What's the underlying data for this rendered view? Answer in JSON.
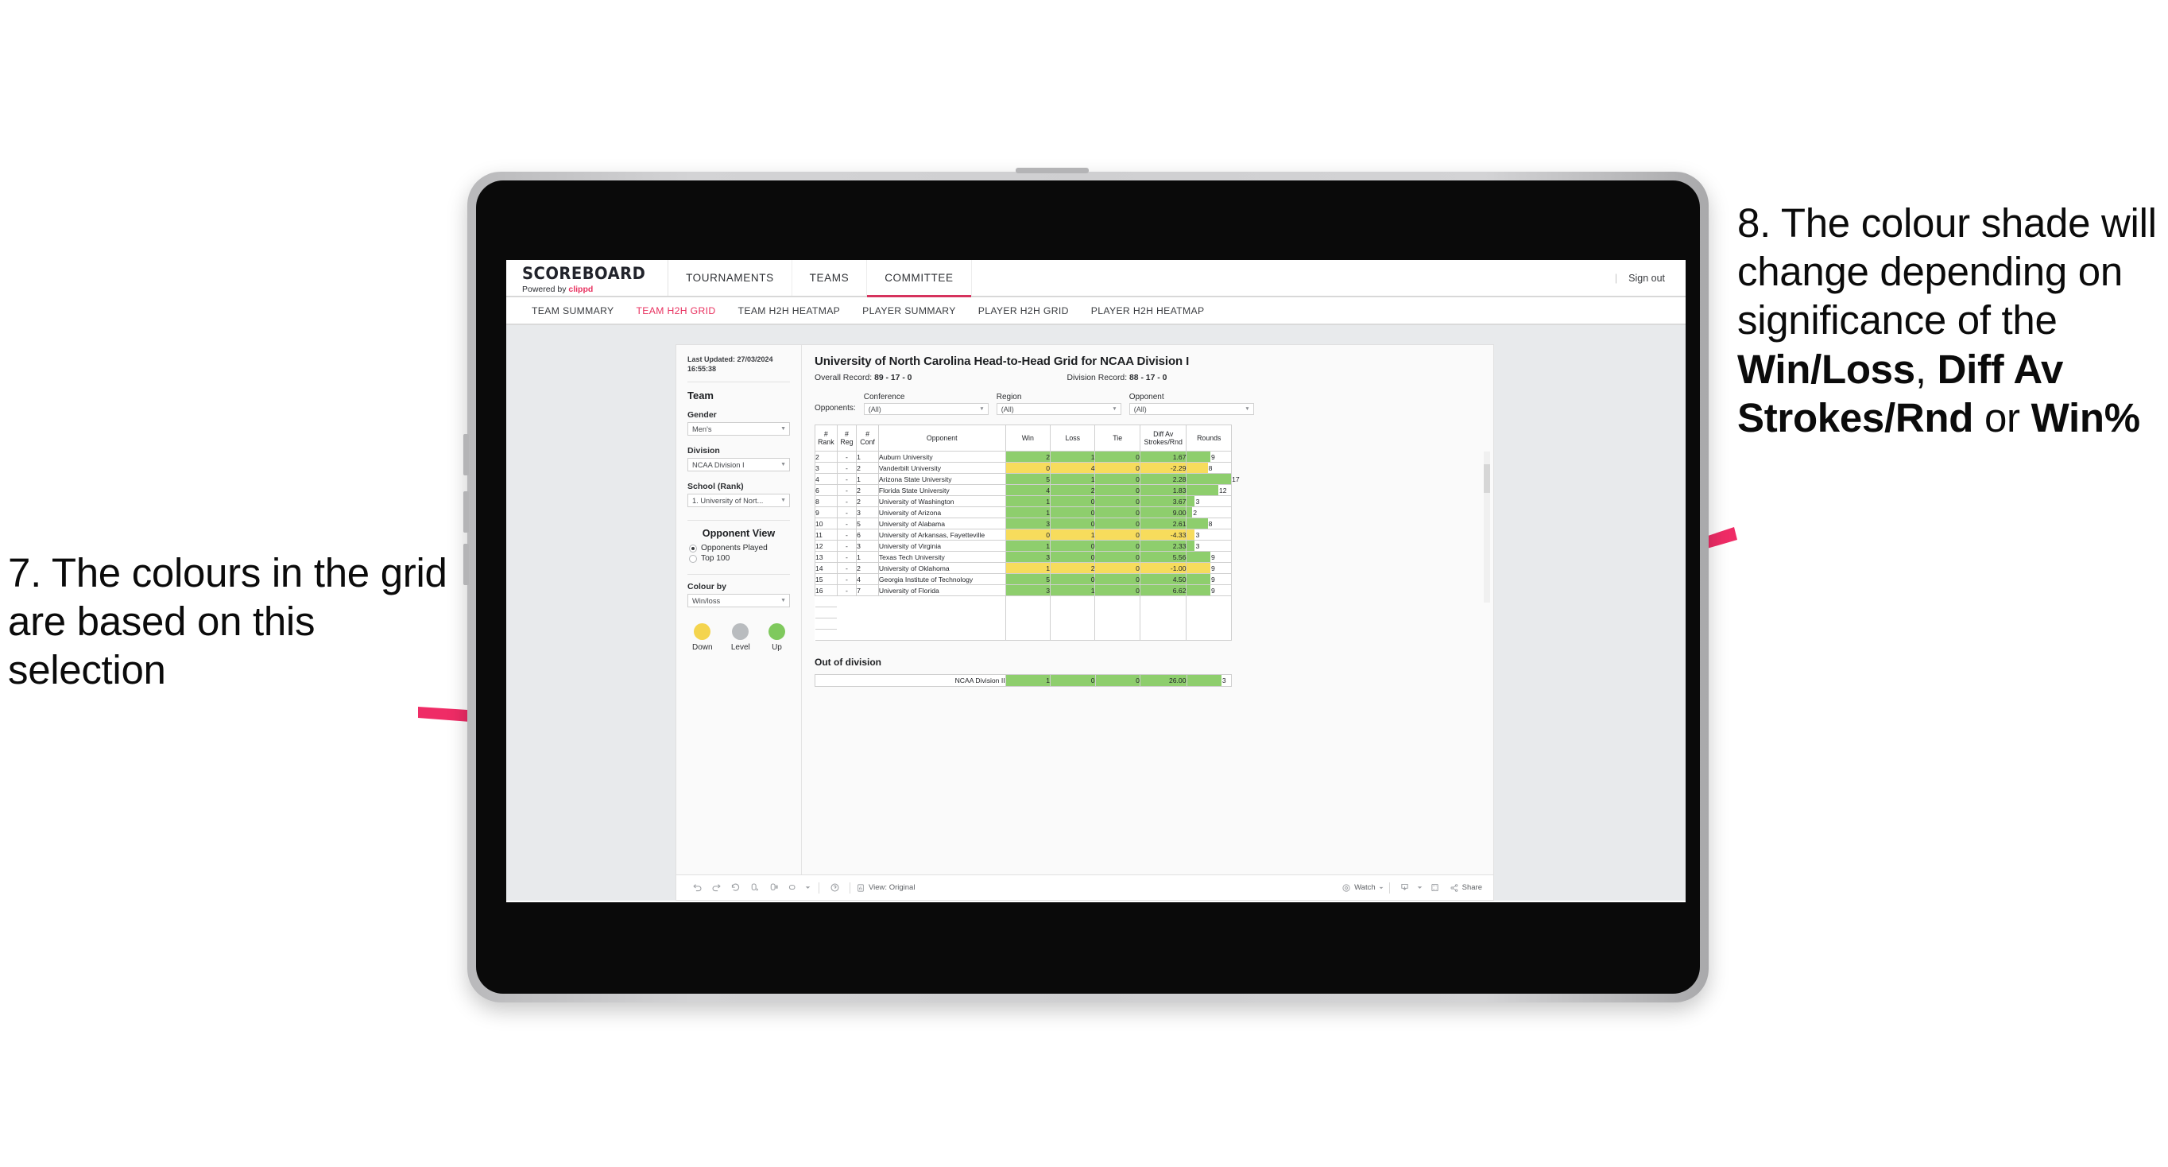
{
  "annotations": {
    "left": {
      "number": "7.",
      "text": "7. The colours in the grid are based on this selection"
    },
    "right": {
      "part1": "8. The colour shade will change depending on significance of the ",
      "bold1": "Win/Loss",
      "mid1": ", ",
      "bold2": "Diff Av Strokes/Rnd",
      "mid2": " or ",
      "bold3": "Win%"
    },
    "arrow_color": "#ef2c66"
  },
  "app": {
    "brand": {
      "title": "SCOREBOARD",
      "powered_prefix": "Powered by ",
      "powered_name": "clippd"
    },
    "main_nav": [
      {
        "label": "TOURNAMENTS",
        "active": false
      },
      {
        "label": "TEAMS",
        "active": false
      },
      {
        "label": "COMMITTEE",
        "active": true
      }
    ],
    "top_right": {
      "separator": "|",
      "sign_out": "Sign out"
    },
    "sub_nav": [
      {
        "label": "TEAM SUMMARY",
        "active": false
      },
      {
        "label": "TEAM H2H GRID",
        "active": true
      },
      {
        "label": "TEAM H2H HEATMAP",
        "active": false
      },
      {
        "label": "PLAYER SUMMARY",
        "active": false
      },
      {
        "label": "PLAYER H2H GRID",
        "active": false
      },
      {
        "label": "PLAYER H2H HEATMAP",
        "active": false
      }
    ]
  },
  "sidebar": {
    "last_updated_line1": "Last Updated: 27/03/2024",
    "last_updated_line2": "16:55:38",
    "team_heading": "Team",
    "gender_label": "Gender",
    "gender_value": "Men's",
    "division_label": "Division",
    "division_value": "NCAA Division I",
    "school_label": "School (Rank)",
    "school_value": "1. University of Nort...",
    "opponent_view_heading": "Opponent View",
    "opponent_view_options": [
      {
        "label": "Opponents Played",
        "selected": true
      },
      {
        "label": "Top 100",
        "selected": false
      }
    ],
    "colour_by_label": "Colour by",
    "colour_by_value": "Win/loss",
    "legend": [
      {
        "label": "Down",
        "color": "#f4d44e"
      },
      {
        "label": "Level",
        "color": "#b9bcbf"
      },
      {
        "label": "Up",
        "color": "#7fc95d"
      }
    ]
  },
  "panel": {
    "title": "University of North Carolina Head-to-Head Grid for NCAA Division I",
    "overall_record_label": "Overall Record: ",
    "overall_record_value": "89 - 17 - 0",
    "division_record_label": "Division Record: ",
    "division_record_value": "88 - 17 - 0",
    "opponents_label": "Opponents:",
    "filters": [
      {
        "caption": "Conference",
        "value": "(All)"
      },
      {
        "caption": "Region",
        "value": "(All)"
      },
      {
        "caption": "Opponent",
        "value": "(All)"
      }
    ],
    "out_of_division_title": "Out of division"
  },
  "chart_data": {
    "type": "table",
    "title": "University of North Carolina Head-to-Head Grid for NCAA Division I",
    "columns": [
      {
        "key": "rank",
        "header_line1": "#",
        "header_line2": "Rank"
      },
      {
        "key": "reg",
        "header_line1": "#",
        "header_line2": "Reg"
      },
      {
        "key": "conf",
        "header_line1": "#",
        "header_line2": "Conf"
      },
      {
        "key": "opp",
        "header_line1": "",
        "header_line2": "Opponent"
      },
      {
        "key": "win",
        "header_line1": "",
        "header_line2": "Win"
      },
      {
        "key": "loss",
        "header_line1": "",
        "header_line2": "Loss"
      },
      {
        "key": "tie",
        "header_line1": "",
        "header_line2": "Tie"
      },
      {
        "key": "diff",
        "header_line1": "Diff Av",
        "header_line2": "Strokes/Rnd"
      },
      {
        "key": "rounds",
        "header_line1": "",
        "header_line2": "Rounds"
      }
    ],
    "rounds_max": 17,
    "colors": {
      "up": "#8ece6d",
      "down": "#f7dc5c"
    },
    "rows": [
      {
        "rank": "2",
        "reg": "-",
        "conf": "1",
        "opp": "Auburn University",
        "win": "2",
        "loss": "1",
        "tie": "0",
        "diff": "1.67",
        "rounds": "9",
        "state": "up"
      },
      {
        "rank": "3",
        "reg": "-",
        "conf": "2",
        "opp": "Vanderbilt University",
        "win": "0",
        "loss": "4",
        "tie": "0",
        "diff": "-2.29",
        "rounds": "8",
        "state": "down"
      },
      {
        "rank": "4",
        "reg": "-",
        "conf": "1",
        "opp": "Arizona State University",
        "win": "5",
        "loss": "1",
        "tie": "0",
        "diff": "2.28",
        "rounds": "17",
        "state": "up"
      },
      {
        "rank": "6",
        "reg": "-",
        "conf": "2",
        "opp": "Florida State University",
        "win": "4",
        "loss": "2",
        "tie": "0",
        "diff": "1.83",
        "rounds": "12",
        "state": "up"
      },
      {
        "rank": "8",
        "reg": "-",
        "conf": "2",
        "opp": "University of Washington",
        "win": "1",
        "loss": "0",
        "tie": "0",
        "diff": "3.67",
        "rounds": "3",
        "state": "up"
      },
      {
        "rank": "9",
        "reg": "-",
        "conf": "3",
        "opp": "University of Arizona",
        "win": "1",
        "loss": "0",
        "tie": "0",
        "diff": "9.00",
        "rounds": "2",
        "state": "up"
      },
      {
        "rank": "10",
        "reg": "-",
        "conf": "5",
        "opp": "University of Alabama",
        "win": "3",
        "loss": "0",
        "tie": "0",
        "diff": "2.61",
        "rounds": "8",
        "state": "up"
      },
      {
        "rank": "11",
        "reg": "-",
        "conf": "6",
        "opp": "University of Arkansas, Fayetteville",
        "win": "0",
        "loss": "1",
        "tie": "0",
        "diff": "-4.33",
        "rounds": "3",
        "state": "down"
      },
      {
        "rank": "12",
        "reg": "-",
        "conf": "3",
        "opp": "University of Virginia",
        "win": "1",
        "loss": "0",
        "tie": "0",
        "diff": "2.33",
        "rounds": "3",
        "state": "up"
      },
      {
        "rank": "13",
        "reg": "-",
        "conf": "1",
        "opp": "Texas Tech University",
        "win": "3",
        "loss": "0",
        "tie": "0",
        "diff": "5.56",
        "rounds": "9",
        "state": "up"
      },
      {
        "rank": "14",
        "reg": "-",
        "conf": "2",
        "opp": "University of Oklahoma",
        "win": "1",
        "loss": "2",
        "tie": "0",
        "diff": "-1.00",
        "rounds": "9",
        "state": "down"
      },
      {
        "rank": "15",
        "reg": "-",
        "conf": "4",
        "opp": "Georgia Institute of Technology",
        "win": "5",
        "loss": "0",
        "tie": "0",
        "diff": "4.50",
        "rounds": "9",
        "state": "up"
      },
      {
        "rank": "16",
        "reg": "-",
        "conf": "7",
        "opp": "University of Florida",
        "win": "3",
        "loss": "1",
        "tie": "0",
        "diff": "6.62",
        "rounds": "9",
        "state": "up"
      }
    ],
    "out_of_division": [
      {
        "label": "NCAA Division II",
        "win": "1",
        "loss": "0",
        "tie": "0",
        "diff": "26.00",
        "rounds": "3",
        "state": "up"
      }
    ]
  },
  "toolbar": {
    "icons": [
      "undo-icon",
      "redo-icon",
      "revert-icon",
      "refresh-icon",
      "pause-icon",
      "custom-views-icon",
      "help-icon"
    ],
    "view_label": "View: Original",
    "watch_label": "Watch",
    "share_label": "Share"
  }
}
